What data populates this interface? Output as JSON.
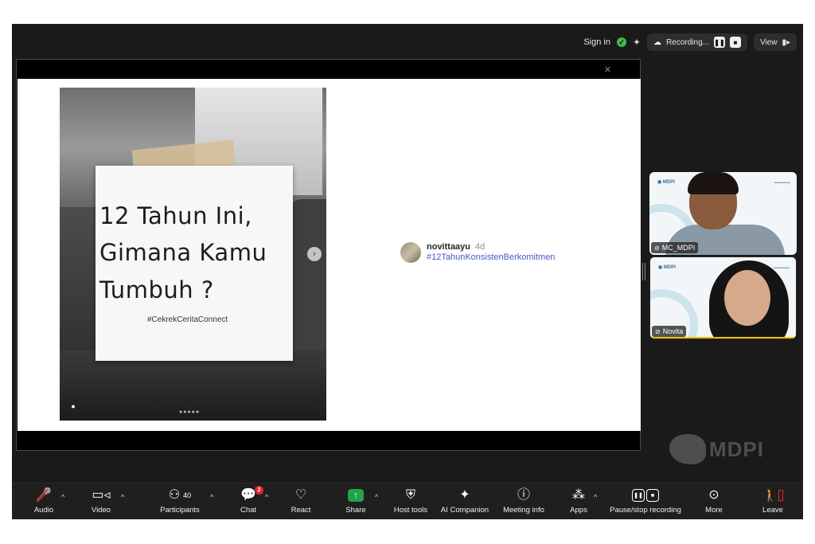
{
  "topbar": {
    "sign_in": "Sign in",
    "recording_label": "Recording...",
    "view_label": "View"
  },
  "shared_post": {
    "paper_line1": "12 Tahun Ini,",
    "paper_line2": "Gimana Kamu",
    "paper_line3": "Tumbuh ?",
    "paper_hashtag": "#CekrekCeritaConnect",
    "username": "novittaayu",
    "time_ago": "4d",
    "hashtag": "#12TahunKonsistenBerkomitmen"
  },
  "participants": [
    {
      "name": "MC_MDPI"
    },
    {
      "name": "Novita"
    }
  ],
  "watermark": {
    "text": "MDPI"
  },
  "toolbar": {
    "audio": "Audio",
    "video": "Video",
    "participants": "Participants",
    "participants_count": "40",
    "chat": "Chat",
    "chat_badge": "2",
    "react": "React",
    "share": "Share",
    "host_tools": "Host tools",
    "ai_companion": "AI Companion",
    "meeting_info": "Meeting info",
    "apps": "Apps",
    "pause_stop_recording": "Pause/stop recording",
    "more": "More",
    "leave": "Leave"
  },
  "icons": {
    "audio": "mic-muted-icon",
    "video": "video-camera-icon",
    "participants": "participants-icon",
    "chat": "chat-bubble-icon",
    "react": "heart-icon",
    "share": "share-arrow-icon",
    "host_tools": "shield-icon",
    "ai_companion": "sparkle-icon",
    "meeting_info": "info-icon",
    "apps": "apps-icon",
    "recording": "pause-stop-icon",
    "more": "more-icon",
    "leave": "leave-door-icon"
  },
  "colors": {
    "window_bg": "#1a1a1a",
    "toolbar_bg": "#1f1f1f",
    "share_green": "#21a34b",
    "alert_red": "#e02828",
    "hashtag_blue": "#4a55c8",
    "security_green": "#3fb950"
  }
}
